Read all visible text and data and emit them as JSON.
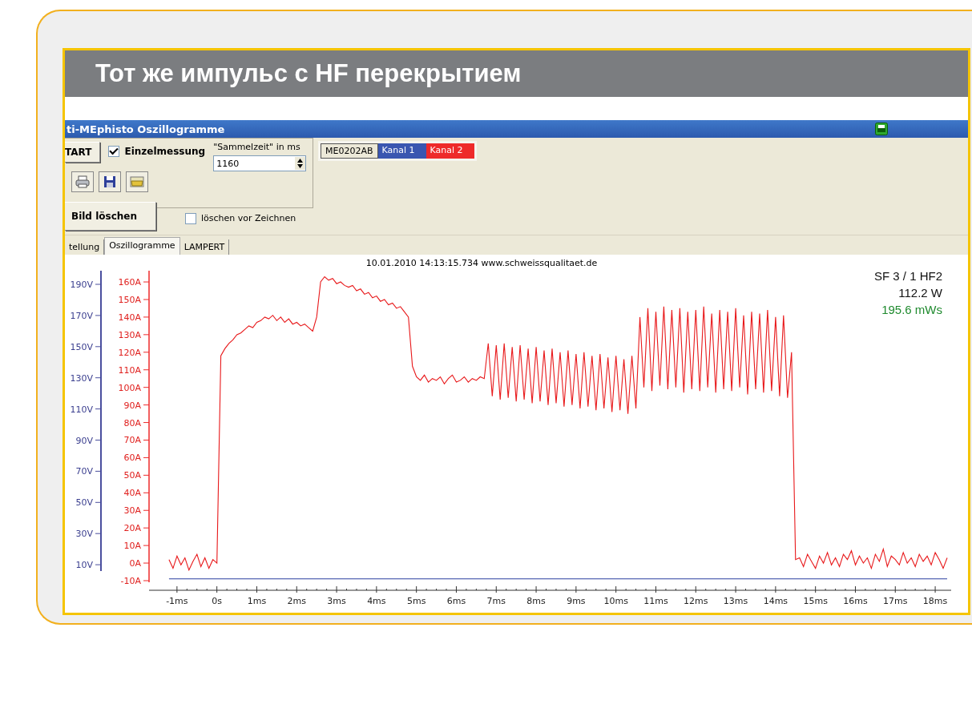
{
  "slide_title": "Тот же импульс с HF перекрытием",
  "window": {
    "title": "ti-MEphisto Oszillogramme"
  },
  "toolbar": {
    "start_button": "TART",
    "single_measure": {
      "label": "Einzelmessung",
      "checked": true
    },
    "collect_label": "\"Sammelzeit\" in ms",
    "collect_value": "1160",
    "clear_button": "Bild löschen",
    "clear_before": {
      "label": "löschen vor Zeichnen",
      "checked": false
    }
  },
  "channels": [
    {
      "label": "ME0202AB",
      "color": "#ece9d8"
    },
    {
      "label": "Kanal 1",
      "color": "#3a56b0"
    },
    {
      "label": "Kanal 2",
      "color": "#ee2a2a"
    }
  ],
  "tabs": [
    {
      "label": "tellung",
      "selected": false
    },
    {
      "label": "Oszillogramme",
      "selected": true
    },
    {
      "label": "LAMPERT",
      "selected": false
    }
  ],
  "plot": {
    "header": "10.01.2010 14:13:15.734 www.schweissqualitaet.de",
    "info": [
      {
        "text": "SF 3 / 1 HF2",
        "kind": "name"
      },
      {
        "text": "112.2 W",
        "kind": "power"
      },
      {
        "text": "195.6 mWs",
        "kind": "energy"
      }
    ],
    "voltage_ticks": [
      "190V",
      "170V",
      "150V",
      "130V",
      "110V",
      "90V",
      "70V",
      "50V",
      "30V",
      "10V"
    ],
    "chart_data": {
      "type": "line",
      "xlim": [
        -1.7,
        18.4
      ],
      "ylim": [
        -10,
        166.4
      ],
      "yticks": [
        {
          "value": 160,
          "label": "160A"
        },
        {
          "value": 150,
          "label": "150A"
        },
        {
          "value": 140,
          "label": "140A"
        },
        {
          "value": 130,
          "label": "130A"
        },
        {
          "value": 120,
          "label": "120A"
        },
        {
          "value": 110,
          "label": "110A"
        },
        {
          "value": 100,
          "label": "100A"
        },
        {
          "value": 90,
          "label": "90A"
        },
        {
          "value": 80,
          "label": "80A"
        },
        {
          "value": 70,
          "label": "70A"
        },
        {
          "value": 60,
          "label": "60A"
        },
        {
          "value": 50,
          "label": "50A"
        },
        {
          "value": 40,
          "label": "40A"
        },
        {
          "value": 30,
          "label": "30A"
        },
        {
          "value": 20,
          "label": "20A"
        },
        {
          "value": 10,
          "label": "10A"
        },
        {
          "value": 0,
          "label": "0A"
        },
        {
          "value": -10,
          "label": "-10A"
        }
      ],
      "xticks": [
        {
          "value": -1,
          "label": "-1ms"
        },
        {
          "value": 0,
          "label": "0s"
        },
        {
          "value": 1,
          "label": "1ms"
        },
        {
          "value": 2,
          "label": "2ms"
        },
        {
          "value": 3,
          "label": "3ms"
        },
        {
          "value": 4,
          "label": "4ms"
        },
        {
          "value": 5,
          "label": "5ms"
        },
        {
          "value": 6,
          "label": "6ms"
        },
        {
          "value": 7,
          "label": "7ms"
        },
        {
          "value": 8,
          "label": "8ms"
        },
        {
          "value": 9,
          "label": "9ms"
        },
        {
          "value": 10,
          "label": "10ms"
        },
        {
          "value": 11,
          "label": "11ms"
        },
        {
          "value": 12,
          "label": "12ms"
        },
        {
          "value": 13,
          "label": "13ms"
        },
        {
          "value": 14,
          "label": "14ms"
        },
        {
          "value": 15,
          "label": "15ms"
        },
        {
          "value": 16,
          "label": "16ms"
        },
        {
          "value": 17,
          "label": "17ms"
        },
        {
          "value": 18,
          "label": "18ms"
        }
      ],
      "x": [
        -1.2,
        -1.1,
        -1.0,
        -0.9,
        -0.8,
        -0.7,
        -0.6,
        -0.5,
        -0.4,
        -0.3,
        -0.2,
        -0.1,
        0.0,
        0.1,
        0.2,
        0.3,
        0.4,
        0.5,
        0.6,
        0.7,
        0.8,
        0.9,
        1.0,
        1.1,
        1.2,
        1.3,
        1.4,
        1.5,
        1.6,
        1.7,
        1.8,
        1.9,
        2.0,
        2.1,
        2.2,
        2.3,
        2.4,
        2.5,
        2.6,
        2.7,
        2.8,
        2.9,
        3.0,
        3.1,
        3.2,
        3.3,
        3.4,
        3.5,
        3.6,
        3.7,
        3.8,
        3.9,
        4.0,
        4.1,
        4.2,
        4.3,
        4.4,
        4.5,
        4.6,
        4.7,
        4.8,
        4.9,
        5.0,
        5.1,
        5.2,
        5.3,
        5.4,
        5.5,
        5.6,
        5.7,
        5.8,
        5.9,
        6.0,
        6.1,
        6.2,
        6.3,
        6.4,
        6.5,
        6.6,
        6.7,
        6.8,
        6.9,
        7.0,
        7.1,
        7.2,
        7.3,
        7.4,
        7.5,
        7.6,
        7.7,
        7.8,
        7.9,
        8.0,
        8.1,
        8.2,
        8.3,
        8.4,
        8.5,
        8.6,
        8.7,
        8.8,
        8.9,
        9.0,
        9.1,
        9.2,
        9.3,
        9.4,
        9.5,
        9.6,
        9.7,
        9.8,
        9.9,
        10.0,
        10.1,
        10.2,
        10.3,
        10.4,
        10.5,
        10.6,
        10.7,
        10.8,
        10.9,
        11.0,
        11.1,
        11.2,
        11.3,
        11.4,
        11.5,
        11.6,
        11.7,
        11.8,
        11.9,
        12.0,
        12.1,
        12.2,
        12.3,
        12.4,
        12.5,
        12.6,
        12.7,
        12.8,
        12.9,
        13.0,
        13.1,
        13.2,
        13.3,
        13.4,
        13.5,
        13.6,
        13.7,
        13.8,
        13.9,
        14.0,
        14.1,
        14.2,
        14.3,
        14.4,
        14.5,
        14.6,
        14.7,
        14.8,
        14.9,
        15.0,
        15.1,
        15.2,
        15.3,
        15.4,
        15.5,
        15.6,
        15.7,
        15.8,
        15.9,
        16.0,
        16.1,
        16.2,
        16.3,
        16.4,
        16.5,
        16.6,
        16.7,
        16.8,
        16.9,
        17.0,
        17.1,
        17.2,
        17.3,
        17.4,
        17.5,
        17.6,
        17.7,
        17.8,
        17.9,
        18.0,
        18.1,
        18.2,
        18.3
      ],
      "series": [
        {
          "color": "#2b3fa0",
          "values": [
            -9,
            -9,
            -9,
            -9,
            -9,
            -9,
            -9,
            -9,
            -9,
            -9,
            -9,
            -9,
            -9,
            -9,
            -9,
            -9,
            -9,
            -9,
            -9,
            -9,
            -9,
            -9,
            -9,
            -9,
            -9,
            -9,
            -9,
            -9,
            -9,
            -9,
            -9,
            -9,
            -9,
            -9,
            -9,
            -9,
            -9,
            -9,
            -9,
            -9,
            -9,
            -9,
            -9,
            -9,
            -9,
            -9,
            -9,
            -9,
            -9,
            -9,
            -9,
            -9,
            -9,
            -9,
            -9,
            -9,
            -9,
            -9,
            -9,
            -9,
            -9,
            -9,
            -9,
            -9,
            -9,
            -9,
            -9,
            -9,
            -9,
            -9,
            -9,
            -9,
            -9,
            -9,
            -9,
            -9,
            -9,
            -9,
            -9,
            -9,
            -9,
            -9,
            -9,
            -9,
            -9,
            -9,
            -9,
            -9,
            -9,
            -9,
            -9,
            -9,
            -9,
            -9,
            -9,
            -9,
            -9,
            -9,
            -9,
            -9,
            -9,
            -9,
            -9,
            -9,
            -9,
            -9,
            -9,
            -9,
            -9,
            -9,
            -9,
            -9,
            -9,
            -9,
            -9,
            -9,
            -9,
            -9,
            -9,
            -9,
            -9,
            -9,
            -9,
            -9,
            -9,
            -9,
            -9,
            -9,
            -9,
            -9,
            -9,
            -9,
            -9,
            -9,
            -9,
            -9,
            -9,
            -9,
            -9,
            -9,
            -9,
            -9,
            -9,
            -9,
            -9,
            -9,
            -9,
            -9,
            -9,
            -9,
            -9,
            -9,
            -9,
            -9,
            -9,
            -9,
            -9,
            -9,
            -9,
            -9,
            -9,
            -9,
            -9,
            -9,
            -9,
            -9,
            -9,
            -9,
            -9,
            -9,
            -9,
            -9,
            -9,
            -9,
            -9,
            -9,
            -9,
            -9,
            -9,
            -9,
            -9,
            -9,
            -9,
            -9,
            -9,
            -9,
            -9,
            -9,
            -9,
            -9,
            -9,
            -9,
            -9,
            -9,
            -9,
            -9
          ]
        },
        {
          "color": "#e8181a",
          "values": [
            2,
            -3,
            4,
            -1,
            3,
            -4,
            1,
            5,
            -2,
            3,
            -3,
            2,
            0,
            118,
            122,
            125,
            127,
            130,
            131,
            133,
            135,
            134,
            137,
            138,
            140,
            139,
            141,
            138,
            140,
            137,
            139,
            136,
            137,
            135,
            136,
            134,
            132,
            140,
            160,
            163,
            161,
            162,
            159,
            160,
            158,
            157,
            158,
            155,
            156,
            153,
            154,
            151,
            152,
            149,
            150,
            147,
            148,
            145,
            146,
            143,
            140,
            112,
            106,
            104,
            107,
            103,
            105,
            104,
            106,
            102,
            105,
            107,
            103,
            104,
            106,
            103,
            105,
            104,
            106,
            105,
            125,
            95,
            124,
            93,
            125,
            94,
            123,
            92,
            124,
            93,
            122,
            91,
            123,
            92,
            121,
            90,
            122,
            91,
            120,
            89,
            121,
            90,
            119,
            88,
            120,
            89,
            118,
            87,
            119,
            88,
            117,
            86,
            118,
            87,
            116,
            85,
            118,
            88,
            140,
            100,
            145,
            98,
            143,
            101,
            146,
            99,
            144,
            100,
            145,
            97,
            143,
            99,
            144,
            98,
            146,
            100,
            142,
            97,
            144,
            99,
            143,
            98,
            145,
            100,
            141,
            96,
            143,
            99,
            142,
            97,
            144,
            98,
            140,
            95,
            141,
            94,
            120,
            2,
            3,
            -2,
            5,
            1,
            -3,
            4,
            0,
            6,
            -1,
            3,
            -2,
            5,
            2,
            7,
            -1,
            4,
            0,
            3,
            -3,
            5,
            1,
            8,
            -2,
            4,
            2,
            -1,
            6,
            0,
            3,
            -2,
            5,
            1,
            4,
            -1,
            6,
            2,
            -3,
            3
          ]
        }
      ]
    }
  }
}
